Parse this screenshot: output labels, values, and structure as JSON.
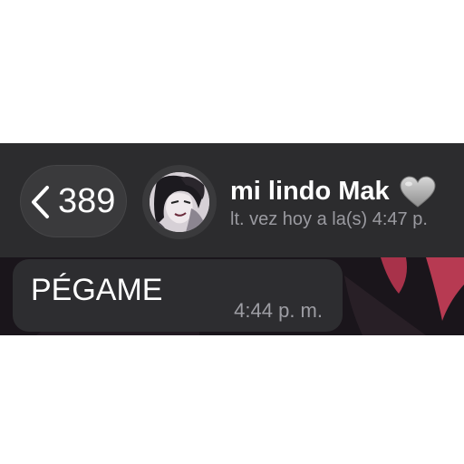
{
  "header": {
    "back": {
      "count": "389",
      "icon": "chevron-left-icon"
    },
    "contact": {
      "name": "mi lindo Mak",
      "status": "lt. vez hoy a la(s) 4:47 p.",
      "status_icon": "gray-heart-icon",
      "avatar_icon": "contact-avatar"
    }
  },
  "messages": [
    {
      "text": "PÉGAME",
      "time": "4:44 p. m."
    }
  ],
  "colors": {
    "header_bg": "#2c2c2e",
    "bubble_bg": "#2d2d30",
    "accent_wallpaper": "#c23a52",
    "text_primary": "#ffffff",
    "text_secondary": "#9a9aa0"
  }
}
